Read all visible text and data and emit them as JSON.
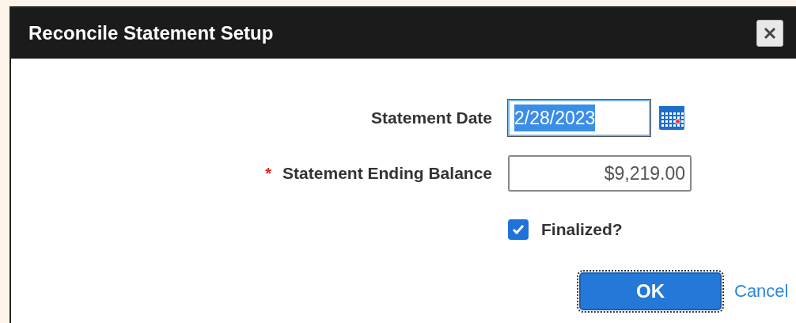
{
  "window": {
    "title": "Reconcile Statement Setup"
  },
  "fields": [
    {
      "label": "Statement Date",
      "value": "2/28/2023",
      "text_selected": true,
      "kind": "date"
    },
    {
      "label": "Statement Ending Balance",
      "required_mark": "*",
      "value": "$9,219.00",
      "text_selected": false,
      "kind": "amount"
    }
  ],
  "finalized": {
    "label": "Finalized?",
    "checked": true
  },
  "buttons": [
    {
      "label": "OK",
      "kind": "primary",
      "focused": true
    },
    {
      "label": "Cancel",
      "kind": "link",
      "focused": false
    }
  ]
}
